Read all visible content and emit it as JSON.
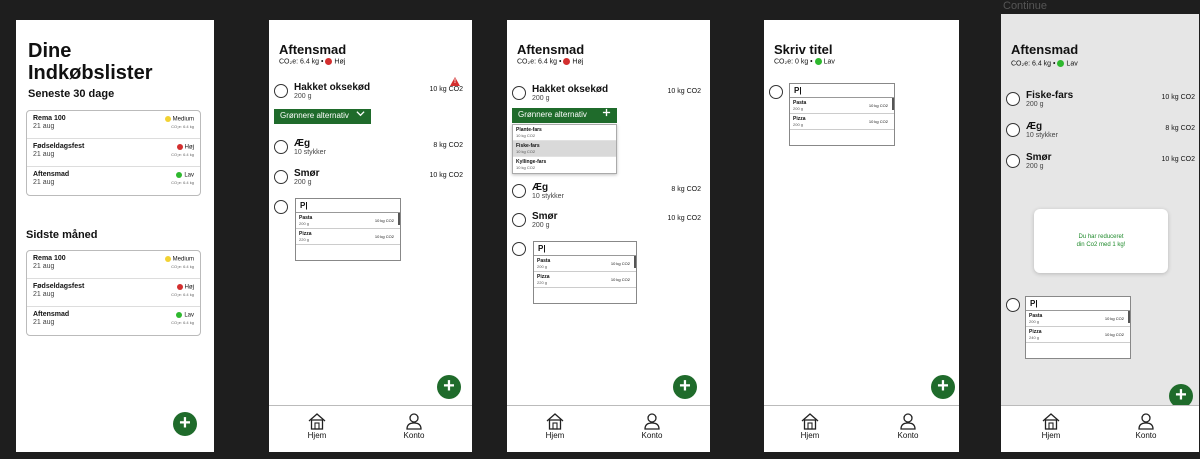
{
  "colors": {
    "accent": "#1f6b2b",
    "medium": "#f2d233",
    "high": "#d32f2f",
    "low": "#2eb82e"
  },
  "nav": {
    "home": "Hjem",
    "account": "Konto"
  },
  "fab_label": "+",
  "faded_top_text": "Continue",
  "screen1": {
    "title_line1": "Dine",
    "title_line2": "Indkøbslister",
    "recent_heading": "Seneste 30 dage",
    "last_month_heading": "Sidste måned",
    "recent": [
      {
        "name": "Rema 100",
        "date": "21 aug",
        "level": "Medium",
        "co2": "CO₂e: 6.4 kg",
        "color": "#f2d233"
      },
      {
        "name": "Fødseldagsfest",
        "date": "21 aug",
        "level": "Høj",
        "co2": "CO₂e: 6.4 kg",
        "color": "#d32f2f"
      },
      {
        "name": "Aftensmad",
        "date": "21 aug",
        "level": "Lav",
        "co2": "CO₂e: 6.4 kg",
        "color": "#2eb82e"
      }
    ],
    "last_month": [
      {
        "name": "Rema 100",
        "date": "21 aug",
        "level": "Medium",
        "co2": "CO₂e: 6.4 kg",
        "color": "#f2d233"
      },
      {
        "name": "Fødseldagsfest",
        "date": "21 aug",
        "level": "Høj",
        "co2": "CO₂e: 6.4 kg",
        "color": "#d32f2f"
      },
      {
        "name": "Aftensmad",
        "date": "21 aug",
        "level": "Lav",
        "co2": "CO₂e: 6.4 kg",
        "color": "#2eb82e"
      }
    ]
  },
  "screen2": {
    "title": "Aftensmad",
    "co2_line": "CO₂e: 6.4 kg  •",
    "level": "Høj",
    "items": [
      {
        "name": "Hakket oksekød",
        "sub": "200 g",
        "kg": "10 kg CO2"
      },
      {
        "name": "Æg",
        "sub": "10 stykker",
        "kg": "8 kg CO2"
      },
      {
        "name": "Smør",
        "sub": "200 g",
        "kg": "10 kg CO2"
      }
    ],
    "greener_label": "Grønnere alternativ",
    "greener_icon": "chevron-down",
    "search_value": "P|",
    "results": [
      {
        "name": "Pasta",
        "sub": "200 g",
        "kg": "10 kg CO2"
      },
      {
        "name": "Pizza",
        "sub": "220 g",
        "kg": "10 kg CO2"
      }
    ]
  },
  "screen3": {
    "title": "Aftensmad",
    "co2_line": "CO₂e: 6.4 kg  •",
    "level": "Høj",
    "items": [
      {
        "name": "Hakket oksekød",
        "sub": "200 g",
        "kg": "10 kg CO2"
      },
      {
        "name": "Æg",
        "sub": "10 stykker",
        "kg": "8 kg CO2"
      },
      {
        "name": "Smør",
        "sub": "200 g",
        "kg": "10 kg CO2"
      }
    ],
    "greener_label": "Grønnere alternativ",
    "greener_icon": "plus",
    "alternatives": [
      {
        "name": "Plante-fars",
        "sub": "10 kg CO2"
      },
      {
        "name": "Fiske-fars",
        "sub": "10 kg CO2"
      },
      {
        "name": "Kyllinge-fars",
        "sub": "10 kg CO2"
      }
    ],
    "search_value": "P|",
    "results": [
      {
        "name": "Pasta",
        "sub": "200 g",
        "kg": "10 kg CO2"
      },
      {
        "name": "Pizza",
        "sub": "220 g",
        "kg": "10 kg CO2"
      }
    ]
  },
  "screen4": {
    "title": "Skriv titel",
    "co2_line": "CO₂e: 0 kg  •",
    "level": "Lav",
    "search_value": "P|",
    "results": [
      {
        "name": "Pasta",
        "sub": "200 g",
        "kg": "10 kg CO2"
      },
      {
        "name": "Pizza",
        "sub": "200 g",
        "kg": "10 kg CO2"
      }
    ]
  },
  "screen5": {
    "title": "Aftensmad",
    "co2_line": "CO₂e: 6.4 kg  •",
    "level": "Lav",
    "items": [
      {
        "name": "Fiske-fars",
        "sub": "200 g",
        "kg": "10 kg CO2"
      },
      {
        "name": "Æg",
        "sub": "10 stykker",
        "kg": "8 kg CO2"
      },
      {
        "name": "Smør",
        "sub": "200 g",
        "kg": "10 kg CO2"
      }
    ],
    "toast_line1": "Du har reduceret",
    "toast_line2": "din Co2 med 1 kg!",
    "search_value": "P|",
    "results": [
      {
        "name": "Pasta",
        "sub": "200 g",
        "kg": "10 kg CO2"
      },
      {
        "name": "Pizza",
        "sub": "240 g",
        "kg": "10 kg CO2"
      }
    ]
  }
}
